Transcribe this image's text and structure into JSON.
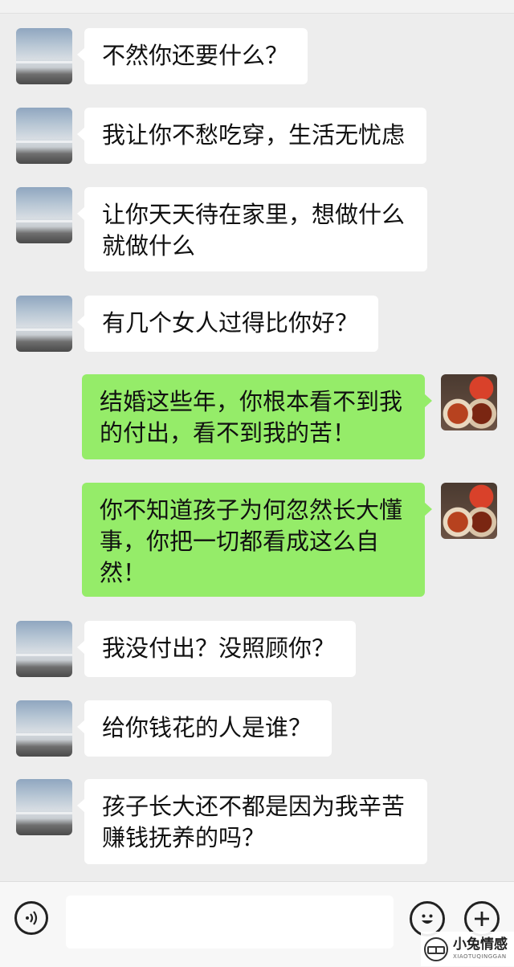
{
  "messages": [
    {
      "side": "left",
      "avatar_icon": "sky-landscape-avatar",
      "text": "不然你还要什么？"
    },
    {
      "side": "left",
      "avatar_icon": "sky-landscape-avatar",
      "text": "我让你不愁吃穿，生活无忧虑"
    },
    {
      "side": "left",
      "avatar_icon": "sky-landscape-avatar",
      "text": "让你天天待在家里，想做什么\n就做什么"
    },
    {
      "side": "left",
      "avatar_icon": "sky-landscape-avatar",
      "text": "有几个女人过得比你好？"
    },
    {
      "side": "right",
      "avatar_icon": "food-bowls-avatar",
      "text": "结婚这些年，你根本看不到我\n的付出，看不到我的苦！"
    },
    {
      "side": "right",
      "avatar_icon": "food-bowls-avatar",
      "text": "你不知道孩子为何忽然长大懂\n事，你把一切都看成这么自\n然！"
    },
    {
      "side": "left",
      "avatar_icon": "sky-landscape-avatar",
      "text": "我没付出？没照顾你？"
    },
    {
      "side": "left",
      "avatar_icon": "sky-landscape-avatar",
      "text": "给你钱花的人是谁？"
    },
    {
      "side": "left",
      "avatar_icon": "sky-landscape-avatar",
      "text": "孩子长大还不都是因为我辛苦\n赚钱抚养的吗？"
    }
  ],
  "input_bar": {
    "voice_icon": "voice-wave-icon",
    "emoji_icon": "smiley-face-icon",
    "plus_icon": "plus-icon",
    "text_value": ""
  },
  "watermark": {
    "title": "小兔情感",
    "subtitle": "XIAOTUQINGGAN"
  },
  "colors": {
    "background": "#ededed",
    "incoming_bubble": "#ffffff",
    "outgoing_bubble": "#95ec69"
  }
}
